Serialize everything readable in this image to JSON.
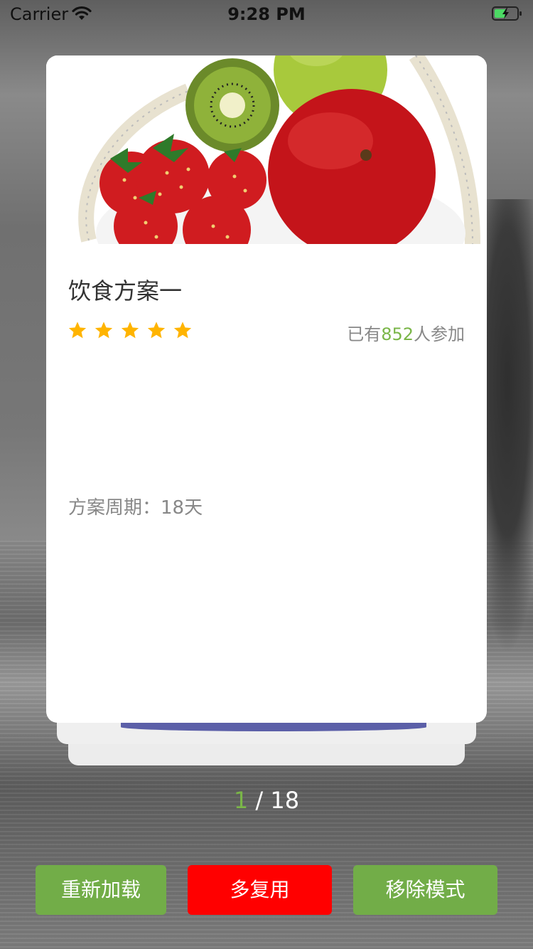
{
  "status_bar": {
    "carrier": "Carrier",
    "time": "9:28 PM"
  },
  "card": {
    "title": "饮食方案一",
    "rating_stars": 5,
    "participants_prefix": "已有",
    "participants_count": "852",
    "participants_suffix": "人参加",
    "cycle_label": "方案周期：",
    "cycle_value": "18天"
  },
  "pager": {
    "current": "1",
    "separator": " / ",
    "total": "18"
  },
  "buttons": {
    "reload": "重新加载",
    "reuse": "多复用",
    "remove_mode": "移除模式"
  },
  "colors": {
    "accent_green": "#72ad48",
    "count_green": "#7ab648",
    "reuse_red": "#ff0000",
    "star": "#ffb400"
  }
}
